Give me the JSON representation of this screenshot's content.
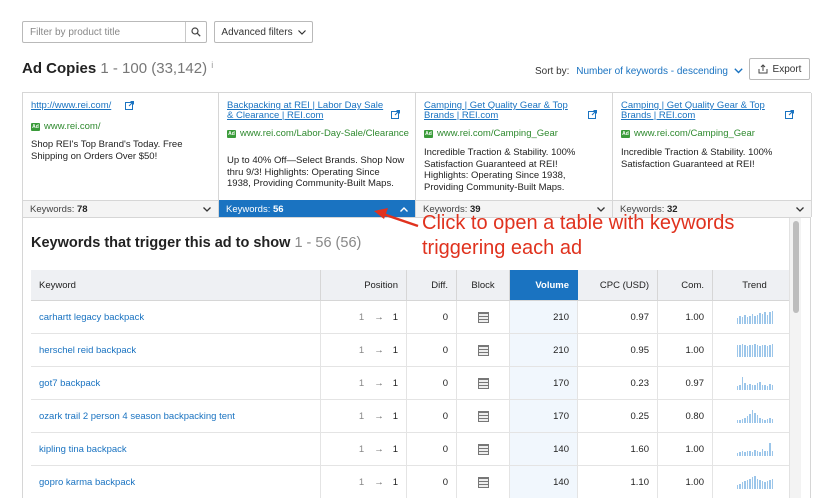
{
  "filter": {
    "placeholder": "Filter by product title"
  },
  "advanced_filters_label": "Advanced filters",
  "section": {
    "title": "Ad Copies",
    "range": "1 - 100 (33,142)",
    "sup": "i"
  },
  "sort": {
    "label": "Sort by:",
    "value": "Number of keywords - descending"
  },
  "export_label": "Export",
  "ads": [
    {
      "title": "http://www.rei.com/",
      "url": "www.rei.com/",
      "description": "Shop REI's Top Brand's Today. Free Shipping on Orders Over $50!",
      "keywords_label": "Keywords:",
      "keywords_count": "78",
      "active": false
    },
    {
      "title": "Backpacking at REI | Labor Day Sale & Clearance | REI.com",
      "url": "www.rei.com/Labor-Day-Sale/Clearance",
      "description": "Up to 40% Off—Select Brands. Shop Now thru 9/3! Highlights: Operating Since 1938, Providing Community-Built Maps.",
      "keywords_label": "Keywords:",
      "keywords_count": "56",
      "active": true
    },
    {
      "title": "Camping | Get Quality Gear & Top Brands | REI.com",
      "url": "www.rei.com/Camping_Gear",
      "description": "Incredible Traction & Stability. 100% Satisfaction Guaranteed at REI! Highlights: Operating Since 1938, Providing Community-Built Maps.",
      "keywords_label": "Keywords:",
      "keywords_count": "39",
      "active": false
    },
    {
      "title": "Camping | Get Quality Gear & Top Brands | REI.com",
      "url": "www.rei.com/Camping_Gear",
      "description": "Incredible Traction & Stability. 100% Satisfaction Guaranteed at REI!",
      "keywords_label": "Keywords:",
      "keywords_count": "32",
      "active": false
    }
  ],
  "keywords_section": {
    "title": "Keywords that trigger this ad to show",
    "range": "1 - 56 (56)"
  },
  "table": {
    "headers": {
      "keyword": "Keyword",
      "position": "Position",
      "diff": "Diff.",
      "block": "Block",
      "volume": "Volume",
      "cpc": "CPC (USD)",
      "com": "Com.",
      "trend": "Trend"
    },
    "rows": [
      {
        "keyword": "carhartt legacy backpack",
        "pos_from": "1",
        "pos_arrow": "→",
        "pos_to": "1",
        "diff": "0",
        "volume": "210",
        "cpc": "0.97",
        "com": "1.00",
        "trend": [
          0.45,
          0.6,
          0.5,
          0.7,
          0.55,
          0.65,
          0.8,
          0.6,
          0.7,
          0.85,
          0.75,
          0.9,
          0.7,
          0.95,
          1.0
        ]
      },
      {
        "keyword": "herschel reid backpack",
        "pos_from": "1",
        "pos_arrow": "→",
        "pos_to": "1",
        "diff": "0",
        "volume": "210",
        "cpc": "0.95",
        "com": "1.00",
        "trend": [
          0.95,
          0.9,
          1.0,
          0.95,
          0.85,
          0.9,
          0.95,
          1.0,
          0.9,
          0.85,
          0.95,
          0.9,
          0.85,
          0.95,
          1.0
        ]
      },
      {
        "keyword": "got7 backpack",
        "pos_from": "1",
        "pos_arrow": "→",
        "pos_to": "1",
        "diff": "0",
        "volume": "170",
        "cpc": "0.23",
        "com": "0.97",
        "trend": [
          0.3,
          0.4,
          1.0,
          0.55,
          0.35,
          0.45,
          0.4,
          0.35,
          0.5,
          0.6,
          0.4,
          0.35,
          0.3,
          0.45,
          0.4
        ]
      },
      {
        "keyword": "ozark trail 2 person 4 season backpacking tent",
        "pos_from": "1",
        "pos_arrow": "→",
        "pos_to": "1",
        "diff": "0",
        "volume": "170",
        "cpc": "0.25",
        "com": "0.80",
        "trend": [
          0.2,
          0.25,
          0.3,
          0.4,
          0.5,
          0.7,
          1.0,
          0.8,
          0.6,
          0.4,
          0.3,
          0.25,
          0.3,
          0.35,
          0.3
        ]
      },
      {
        "keyword": "kipling tina backpack",
        "pos_from": "1",
        "pos_arrow": "→",
        "pos_to": "1",
        "diff": "0",
        "volume": "140",
        "cpc": "1.60",
        "com": "1.00",
        "trend": [
          0.25,
          0.3,
          0.35,
          0.3,
          0.4,
          0.35,
          0.3,
          0.45,
          0.35,
          0.3,
          0.5,
          0.4,
          0.35,
          1.0,
          0.4
        ]
      },
      {
        "keyword": "gopro karma backpack",
        "pos_from": "1",
        "pos_arrow": "→",
        "pos_to": "1",
        "diff": "0",
        "volume": "140",
        "cpc": "1.10",
        "com": "1.00",
        "trend": [
          0.3,
          0.4,
          0.5,
          0.6,
          0.7,
          0.8,
          0.9,
          1.0,
          0.8,
          0.7,
          0.6,
          0.5,
          0.6,
          0.7,
          0.8
        ]
      }
    ]
  },
  "annotation": {
    "text": "Click to open a table with keywords triggering each ad"
  },
  "colors": {
    "accent": "#1a73c1",
    "link": "#1a73c1",
    "url_green": "#2f8a2f",
    "annotation": "#e0321e"
  }
}
